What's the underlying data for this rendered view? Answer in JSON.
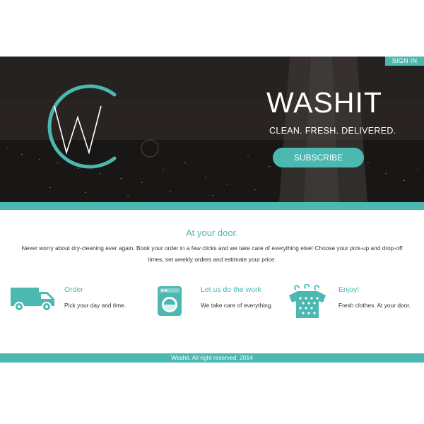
{
  "header": {
    "signin_label": "SIGN IN",
    "brand": "WASHIT",
    "tagline": "CLEAN. FRESH. DELIVERED.",
    "subscribe_label": "SUBSCRIBE"
  },
  "intro": {
    "title": "At your door.",
    "text": "Never worry about dry-cleaning ever again. Book your order in a few clicks and we take care of everything else! Choose your pick-up and drop-off times, set weekly orders and estimate your price."
  },
  "features": [
    {
      "icon": "van-icon",
      "title": "Order",
      "text": "Pick your day and time."
    },
    {
      "icon": "washing-machine-icon",
      "title": "Let us do the work",
      "text": "We take care of everything."
    },
    {
      "icon": "clothes-hanger-icon",
      "title": "Enjoy!",
      "text": "Fresh clothes. At your door."
    }
  ],
  "footer": {
    "text": "Washit. All right reserved. 2014"
  },
  "colors": {
    "accent": "#4bb8b2",
    "text": "#333333",
    "hero_dark": "#2a2624"
  }
}
